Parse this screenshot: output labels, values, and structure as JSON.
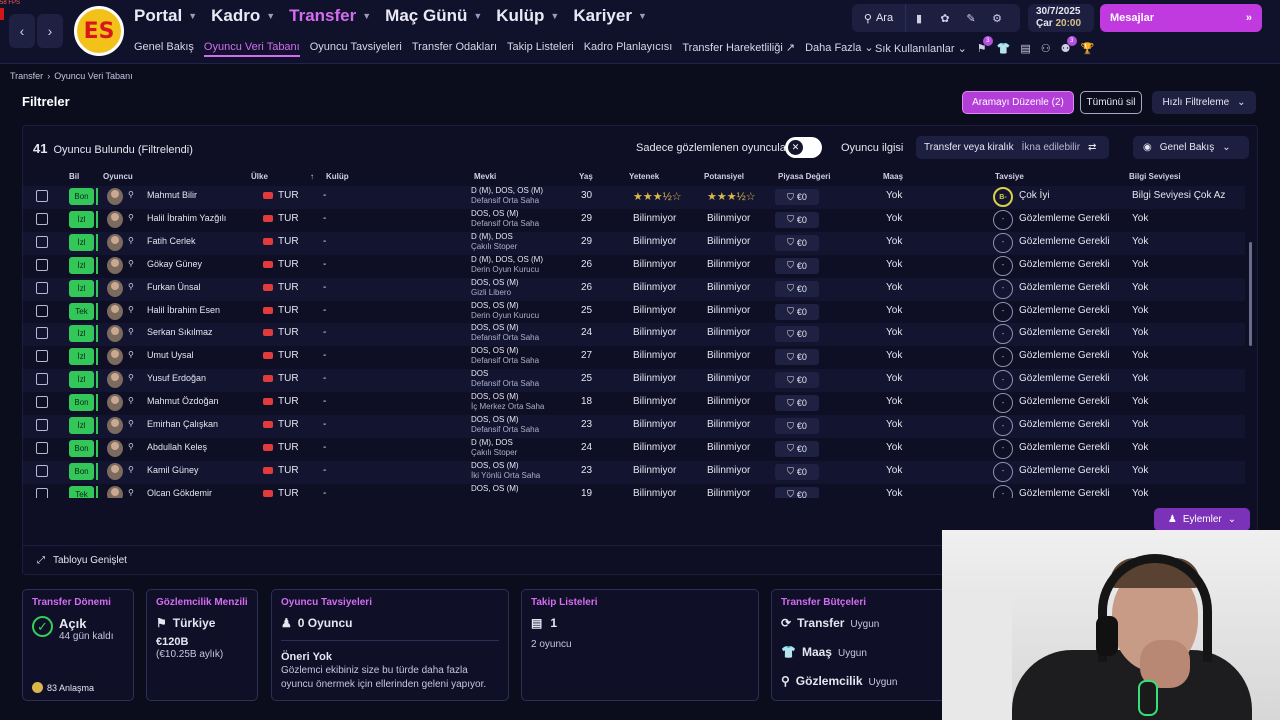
{
  "fps": "58 FPS",
  "nav": {
    "main": [
      {
        "label": "Portal",
        "active": false
      },
      {
        "label": "Kadro",
        "active": false
      },
      {
        "label": "Transfer",
        "active": true
      },
      {
        "label": "Maç Günü",
        "active": false
      },
      {
        "label": "Kulüp",
        "active": false
      },
      {
        "label": "Kariyer",
        "active": false
      }
    ],
    "sub": [
      {
        "label": "Genel Bakış",
        "active": false
      },
      {
        "label": "Oyuncu Veri Tabanı",
        "active": true
      },
      {
        "label": "Oyuncu Tavsiyeleri",
        "active": false
      },
      {
        "label": "Transfer Odakları",
        "active": false
      },
      {
        "label": "Takip Listeleri",
        "active": false
      },
      {
        "label": "Kadro Planlayıcısı",
        "active": false
      },
      {
        "label": "Transfer Hareketliliği",
        "active": false
      },
      {
        "label": "Daha Fazla",
        "active": false
      }
    ]
  },
  "topbar": {
    "search_label": "Ara",
    "date": "30/7/2025",
    "day": "Çar",
    "time": "20:00",
    "messages_label": "Mesajlar",
    "favorites_label": "Sık Kullanılanlar",
    "badge_count_1": "3",
    "badge_count_2": "3"
  },
  "breadcrumb": {
    "root": "Transfer",
    "current": "Oyuncu Veri Tabanı"
  },
  "header": {
    "title": "Filtreler",
    "edit_search": "Aramayı Düzenle (2)",
    "clear_all": "Tümünü sil",
    "quick_filter": "Hızlı Filtreleme"
  },
  "table": {
    "found_count": "41",
    "found_label": "Oyuncu Bulundu (Filtrelendi)",
    "observed_only_label": "Sadece gözlemlenen oyuncular",
    "interest_label": "Oyuncu ilgisi",
    "transfer_filter": "Transfer veya kiralık",
    "transfer_filter_hint": "İkna edilebilir",
    "view_label": "Genel Bakış",
    "columns": {
      "knowledge": "Bil",
      "player": "Oyuncu",
      "nation": "Ülke",
      "club": "Kulüp",
      "position": "Mevki",
      "age": "Yaş",
      "ability": "Yetenek",
      "potential": "Potansiyel",
      "value": "Piyasa Değeri",
      "wage": "Maaş",
      "recommendation": "Tavsiye",
      "knowledge_level": "Bilgi Seviyesi"
    },
    "rows": [
      {
        "rel": "Bon",
        "name": "Mahmut Bilir",
        "nat": "TUR",
        "club": "-",
        "pos": "D (M), DOS, OS (M)",
        "role": "Defansif Orta Saha",
        "age": "30",
        "ability": "★★★½☆",
        "potential": "★★★½☆",
        "value": "€0",
        "wage": "Yok",
        "rec_icon": "B-",
        "rec": "Çok İyi",
        "know": "Bilgi Seviyesi Çok Az"
      },
      {
        "rel": "İzl",
        "name": "Halil İbrahim Yazğılı",
        "nat": "TUR",
        "club": "-",
        "pos": "DOS, OS (M)",
        "role": "Defansif Orta Saha",
        "age": "29",
        "ability": "Bilinmiyor",
        "potential": "Bilinmiyor",
        "value": "€0",
        "wage": "Yok",
        "rec_icon": "-",
        "rec": "Gözlemleme Gerekli",
        "know": "Yok"
      },
      {
        "rel": "İzl",
        "name": "Fatih Cerlek",
        "nat": "TUR",
        "club": "-",
        "pos": "D (M), DOS",
        "role": "Çakılı Stoper",
        "age": "29",
        "ability": "Bilinmiyor",
        "potential": "Bilinmiyor",
        "value": "€0",
        "wage": "Yok",
        "rec_icon": "-",
        "rec": "Gözlemleme Gerekli",
        "know": "Yok"
      },
      {
        "rel": "İzl",
        "name": "Gökay Güney",
        "nat": "TUR",
        "club": "-",
        "pos": "D (M), DOS, OS (M)",
        "role": "Derin Oyun Kurucu",
        "age": "26",
        "ability": "Bilinmiyor",
        "potential": "Bilinmiyor",
        "value": "€0",
        "wage": "Yok",
        "rec_icon": "-",
        "rec": "Gözlemleme Gerekli",
        "know": "Yok"
      },
      {
        "rel": "İzl",
        "name": "Furkan Ünsal",
        "nat": "TUR",
        "club": "-",
        "pos": "DOS, OS (M)",
        "role": "Gizli Libero",
        "age": "26",
        "ability": "Bilinmiyor",
        "potential": "Bilinmiyor",
        "value": "€0",
        "wage": "Yok",
        "rec_icon": "-",
        "rec": "Gözlemleme Gerekli",
        "know": "Yok"
      },
      {
        "rel": "Tek",
        "name": "Halil İbrahim Esen",
        "nat": "TUR",
        "club": "-",
        "pos": "DOS, OS (M)",
        "role": "Derin Oyun Kurucu",
        "age": "25",
        "ability": "Bilinmiyor",
        "potential": "Bilinmiyor",
        "value": "€0",
        "wage": "Yok",
        "rec_icon": "-",
        "rec": "Gözlemleme Gerekli",
        "know": "Yok"
      },
      {
        "rel": "İzl",
        "name": "Serkan Sıkılmaz",
        "nat": "TUR",
        "club": "-",
        "pos": "DOS, OS (M)",
        "role": "Defansif Orta Saha",
        "age": "24",
        "ability": "Bilinmiyor",
        "potential": "Bilinmiyor",
        "value": "€0",
        "wage": "Yok",
        "rec_icon": "-",
        "rec": "Gözlemleme Gerekli",
        "know": "Yok"
      },
      {
        "rel": "İzl",
        "name": "Umut Uysal",
        "nat": "TUR",
        "club": "-",
        "pos": "DOS, OS (M)",
        "role": "Defansif Orta Saha",
        "age": "27",
        "ability": "Bilinmiyor",
        "potential": "Bilinmiyor",
        "value": "€0",
        "wage": "Yok",
        "rec_icon": "-",
        "rec": "Gözlemleme Gerekli",
        "know": "Yok"
      },
      {
        "rel": "İzl",
        "name": "Yusuf Erdoğan",
        "nat": "TUR",
        "club": "-",
        "pos": "DOS",
        "role": "Defansif Orta Saha",
        "age": "25",
        "ability": "Bilinmiyor",
        "potential": "Bilinmiyor",
        "value": "€0",
        "wage": "Yok",
        "rec_icon": "-",
        "rec": "Gözlemleme Gerekli",
        "know": "Yok"
      },
      {
        "rel": "Bon",
        "name": "Mahmut Özdoğan",
        "nat": "TUR",
        "club": "-",
        "pos": "DOS, OS (M)",
        "role": "İç Merkez Orta Saha",
        "age": "18",
        "ability": "Bilinmiyor",
        "potential": "Bilinmiyor",
        "value": "€0",
        "wage": "Yok",
        "rec_icon": "-",
        "rec": "Gözlemleme Gerekli",
        "know": "Yok"
      },
      {
        "rel": "İzl",
        "name": "Emirhan Çalışkan",
        "nat": "TUR",
        "club": "-",
        "pos": "DOS, OS (M)",
        "role": "Defansif Orta Saha",
        "age": "23",
        "ability": "Bilinmiyor",
        "potential": "Bilinmiyor",
        "value": "€0",
        "wage": "Yok",
        "rec_icon": "-",
        "rec": "Gözlemleme Gerekli",
        "know": "Yok"
      },
      {
        "rel": "Bon",
        "name": "Abdullah Keleş",
        "nat": "TUR",
        "club": "-",
        "pos": "D (M), DOS",
        "role": "Çakılı Stoper",
        "age": "24",
        "ability": "Bilinmiyor",
        "potential": "Bilinmiyor",
        "value": "€0",
        "wage": "Yok",
        "rec_icon": "-",
        "rec": "Gözlemleme Gerekli",
        "know": "Yok"
      },
      {
        "rel": "Bon",
        "name": "Kamil Güney",
        "nat": "TUR",
        "club": "-",
        "pos": "DOS, OS (M)",
        "role": "İki Yönlü Orta Saha",
        "age": "23",
        "ability": "Bilinmiyor",
        "potential": "Bilinmiyor",
        "value": "€0",
        "wage": "Yok",
        "rec_icon": "-",
        "rec": "Gözlemleme Gerekli",
        "know": "Yok"
      },
      {
        "rel": "Tek",
        "name": "Olcan Gökdemir",
        "nat": "TUR",
        "club": "-",
        "pos": "DOS, OS (M)",
        "role": "",
        "age": "19",
        "ability": "Bilinmiyor",
        "potential": "Bilinmiyor",
        "value": "€0",
        "wage": "Yok",
        "rec_icon": "-",
        "rec": "Gözlemleme Gerekli",
        "know": "Yok"
      }
    ],
    "actions_label": "Eylemler",
    "expand_label": "Tabloyu Genişlet"
  },
  "cards": {
    "window": {
      "title": "Transfer Dönemi",
      "status": "Açık",
      "days_left": "44 gün kaldı",
      "deals": "83 Anlaşma"
    },
    "scouting": {
      "title": "Gözlemcilik Menzili",
      "region": "Türkiye",
      "cost": "€120B",
      "monthly": "(€10.25B aylık)"
    },
    "recommendations": {
      "title": "Oyuncu Tavsiyeleri",
      "count": "0 Oyuncu",
      "none_title": "Öneri Yok",
      "none_desc": "Gözlemci ekibiniz size bu türde daha fazla oyuncu önermek için ellerinden geleni yapıyor."
    },
    "shortlists": {
      "title": "Takip Listeleri",
      "count": "1",
      "players": "2 oyuncu"
    },
    "budgets": {
      "title": "Transfer Bütçeleri",
      "items": [
        {
          "label": "Transfer",
          "status": "Uygun"
        },
        {
          "label": "Maaş",
          "status": "Uygun"
        },
        {
          "label": "Gözlemcilik",
          "status": "Uygun"
        }
      ]
    }
  }
}
